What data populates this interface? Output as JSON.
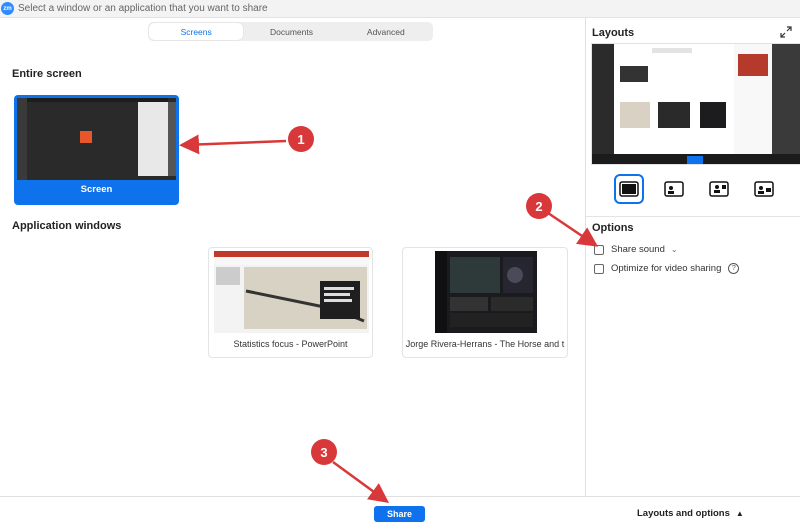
{
  "window": {
    "title": "Select a window or an application that you want to share",
    "logo_text": "zm"
  },
  "tabs": [
    {
      "label": "Screens",
      "active": true
    },
    {
      "label": "Documents",
      "active": false
    },
    {
      "label": "Advanced",
      "active": false
    }
  ],
  "entire_screen": {
    "title": "Entire screen",
    "screen_label": "Screen"
  },
  "application_windows": {
    "title": "Application windows",
    "items": [
      {
        "label": "Statistics focus - PowerPoint"
      },
      {
        "label": "Jorge Rivera-Herrans - The Horse and t"
      }
    ]
  },
  "layouts": {
    "title": "Layouts"
  },
  "options": {
    "title": "Options",
    "items": [
      {
        "label": "Share sound",
        "checked": false
      },
      {
        "label": "Optimize for video sharing",
        "checked": false
      }
    ]
  },
  "footer": {
    "share_label": "Share",
    "layouts_options_label": "Layouts and options"
  },
  "annotations": {
    "badge1": "1",
    "badge2": "2",
    "badge3": "3"
  },
  "colors": {
    "accent": "#0e72ed",
    "annotation": "#d9383a"
  }
}
